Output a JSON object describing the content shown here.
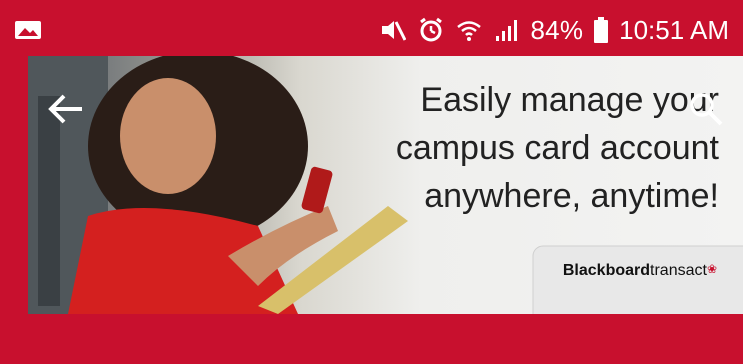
{
  "status_bar": {
    "battery_pct": "84%",
    "time": "10:51 AM",
    "icons": [
      "image-icon",
      "mute-icon",
      "alarm-icon",
      "wifi-icon",
      "signal-icon",
      "battery-icon"
    ]
  },
  "banner": {
    "lines": [
      "Easily manage your",
      "campus card account",
      "anywhere, anytime!"
    ],
    "logo_bold": "Blackboard",
    "logo_light": "transact"
  },
  "colors": {
    "brand_red": "#c8102e",
    "text_dark": "#222222",
    "white": "#ffffff"
  },
  "nav": {
    "back_icon": "arrow-left-icon",
    "search_icon": "search-icon"
  }
}
